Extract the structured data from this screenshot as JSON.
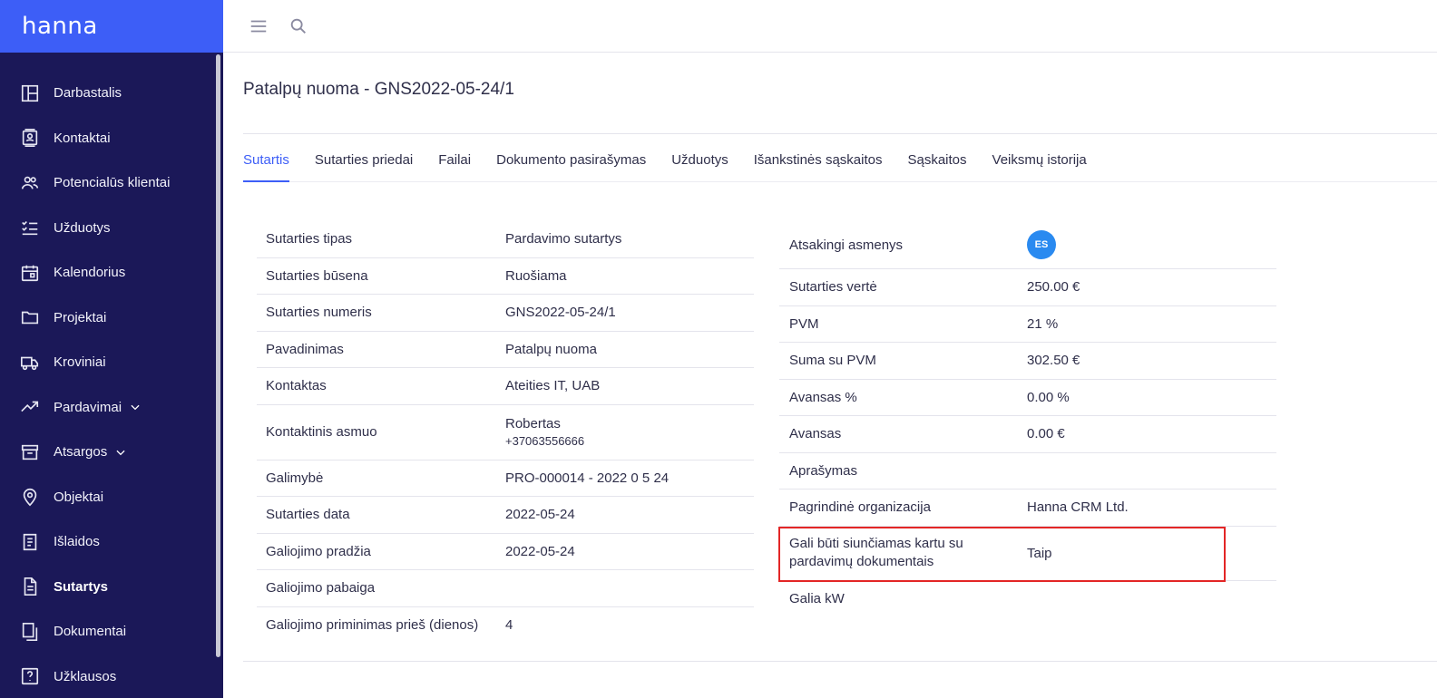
{
  "app": {
    "logo": "hanna"
  },
  "sidebar": {
    "items": [
      {
        "label": "Darbastalis",
        "icon": "dashboard-icon"
      },
      {
        "label": "Kontaktai",
        "icon": "contacts-icon"
      },
      {
        "label": "Potencialūs klientai",
        "icon": "people-icon"
      },
      {
        "label": "Užduotys",
        "icon": "checklist-icon"
      },
      {
        "label": "Kalendorius",
        "icon": "calendar-icon"
      },
      {
        "label": "Projektai",
        "icon": "folder-icon"
      },
      {
        "label": "Kroviniai",
        "icon": "truck-icon"
      },
      {
        "label": "Pardavimai",
        "icon": "trending-up-icon"
      },
      {
        "label": "Atsargos",
        "icon": "archive-icon"
      },
      {
        "label": "Objektai",
        "icon": "location-pin-icon"
      },
      {
        "label": "Išlaidos",
        "icon": "receipt-icon"
      },
      {
        "label": "Sutartys",
        "icon": "document-icon"
      },
      {
        "label": "Dokumentai",
        "icon": "copy-document-icon"
      },
      {
        "label": "Užklausos",
        "icon": "help-icon"
      }
    ],
    "active": "Sutartys"
  },
  "topbar": {
    "icons": [
      "menu-icon",
      "search-icon"
    ]
  },
  "page": {
    "title": "Patalpų nuoma - GNS2022-05-24/1"
  },
  "tabs": [
    {
      "label": "Sutartis"
    },
    {
      "label": "Sutarties priedai"
    },
    {
      "label": "Failai"
    },
    {
      "label": "Dokumento pasirašymas"
    },
    {
      "label": "Užduotys"
    },
    {
      "label": "Išankstinės sąskaitos"
    },
    {
      "label": "Sąskaitos"
    },
    {
      "label": "Veiksmų istorija"
    }
  ],
  "left": {
    "contract_type": {
      "label": "Sutarties tipas",
      "value": "Pardavimo sutartys"
    },
    "status": {
      "label": "Sutarties būsena",
      "value": "Ruošiama"
    },
    "number": {
      "label": "Sutarties numeris",
      "value": "GNS2022-05-24/1"
    },
    "name": {
      "label": "Pavadinimas",
      "value": "Patalpų nuoma"
    },
    "contact": {
      "label": "Kontaktas",
      "value": "Ateities IT, UAB"
    },
    "contact_person": {
      "label": "Kontaktinis asmuo",
      "value": "Robertas",
      "phone": "+37063556666"
    },
    "opportunity": {
      "label": "Galimybė",
      "value": "PRO-000014 - 2022 0 5 24"
    },
    "date": {
      "label": "Sutarties data",
      "value": "2022-05-24"
    },
    "valid_from": {
      "label": "Galiojimo pradžia",
      "value": "2022-05-24"
    },
    "valid_to": {
      "label": "Galiojimo pabaiga",
      "value": ""
    },
    "reminder": {
      "label": "Galiojimo priminimas prieš (dienos)",
      "value": "4"
    }
  },
  "right": {
    "responsible": {
      "label": "Atsakingi asmenys",
      "avatar": "ES"
    },
    "value": {
      "label": "Sutarties vertė",
      "value": "250.00 €"
    },
    "vat": {
      "label": "PVM",
      "value": "21 %"
    },
    "total": {
      "label": "Suma su PVM",
      "value": "302.50 €"
    },
    "advance_pct": {
      "label": "Avansas %",
      "value": "0.00 %"
    },
    "advance": {
      "label": "Avansas",
      "value": "0.00 €"
    },
    "description": {
      "label": "Aprašymas",
      "value": ""
    },
    "organization": {
      "label": "Pagrindinė organizacija",
      "value": "Hanna CRM Ltd."
    },
    "send_with_docs": {
      "label_line1": "Gali būti siunčiamas kartu su",
      "label_line2": "pardavimų dokumentais",
      "value": "Taip"
    },
    "power": {
      "label": "Galia kW",
      "value": ""
    }
  },
  "colors": {
    "sidebar_bg": "#1b1858",
    "brand": "#3d5ef7",
    "link": "#4a5ff0",
    "highlight": "#e32626",
    "avatar": "#2a8af0"
  }
}
